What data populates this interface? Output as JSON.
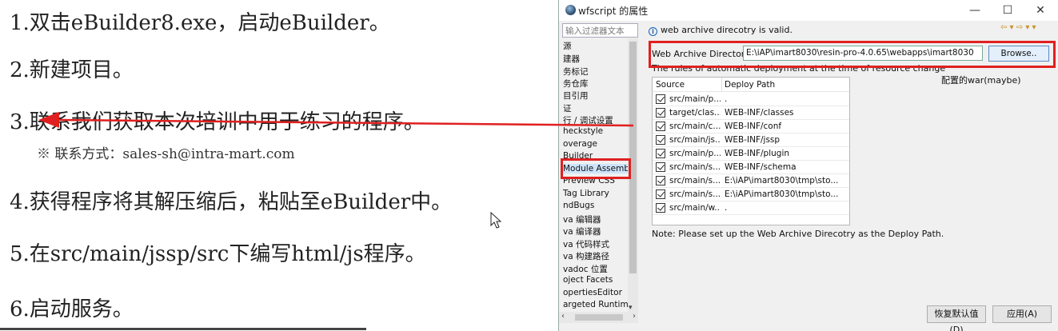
{
  "slide": {
    "steps": [
      "1.双击eBuilder8.exe，启动eBuilder。",
      "2.新建项目。",
      "3.联系我们获取本次培训中用于练习的程序。",
      "4.获得程序将其解压缩后，粘贴至eBuilder中。",
      "5.在src/main/jssp/src下编写html/js程序。",
      "6.启动服务。"
    ],
    "contact": "※ 联系方式：sales-sh@intra-mart.com"
  },
  "dialog": {
    "title": "wfscript 的属性",
    "window_buttons": {
      "minimize": "—",
      "maximize": "☐",
      "close": "✕"
    },
    "filter_placeholder": "输入过滤器文本",
    "nav_items": [
      "源",
      "建器",
      "务标记",
      "务仓库",
      "目引用",
      "证",
      "行 / 调试设置",
      "heckstyle",
      "overage",
      "Builder",
      "Module Assemb",
      "Preview CSS",
      "Tag Library",
      "ndBugs",
      "va 编辑器",
      "va 编译器",
      "va 代码样式",
      "va 构建路径",
      "vadoc 位置",
      "oject Facets",
      "opertiesEditor",
      "argeted Runtime"
    ],
    "selected_nav_index": 10,
    "info_message": "web archive direcotry is valid.",
    "history_arrows": "⇦ ▾ ⇨ ▾ ▾",
    "web_dir_label": "Web Archive Directory",
    "web_dir_value": "E:\\iAP\\imart8030\\resin-pro-4.0.65\\webapps\\imart8030",
    "browse_label": "Browse..",
    "rules_text": "The rules of automatic deployment at the time of resource change",
    "annotation": "配置的war(maybe)",
    "table": {
      "headers": [
        "Source",
        "Deploy Path"
      ],
      "rows": [
        {
          "source": "src/main/p...",
          "deploy": "."
        },
        {
          "source": "target/clas...",
          "deploy": "WEB-INF/classes"
        },
        {
          "source": "src/main/c...",
          "deploy": "WEB-INF/conf"
        },
        {
          "source": "src/main/js...",
          "deploy": "WEB-INF/jssp"
        },
        {
          "source": "src/main/p...",
          "deploy": "WEB-INF/plugin"
        },
        {
          "source": "src/main/s...",
          "deploy": "WEB-INF/schema"
        },
        {
          "source": "src/main/s...",
          "deploy": "E:\\iAP\\imart8030\\tmp\\sto..."
        },
        {
          "source": "src/main/s...",
          "deploy": "E:\\iAP\\imart8030\\tmp\\sto..."
        },
        {
          "source": "src/main/w...",
          "deploy": "."
        }
      ]
    },
    "note": "Note: Please set up the Web Archive Direcotry as the Deploy Path.",
    "restore_button": "恢复默认值(D)",
    "apply_button": "应用(A)"
  },
  "colors": {
    "highlight": "#e02020",
    "selection": "#cde4fb",
    "browse_border": "#5a8ac6"
  },
  "icons": [
    "app-icon",
    "info-icon",
    "checkbox-checked-icon",
    "mouse-cursor-icon",
    "red-arrow-annotation"
  ]
}
